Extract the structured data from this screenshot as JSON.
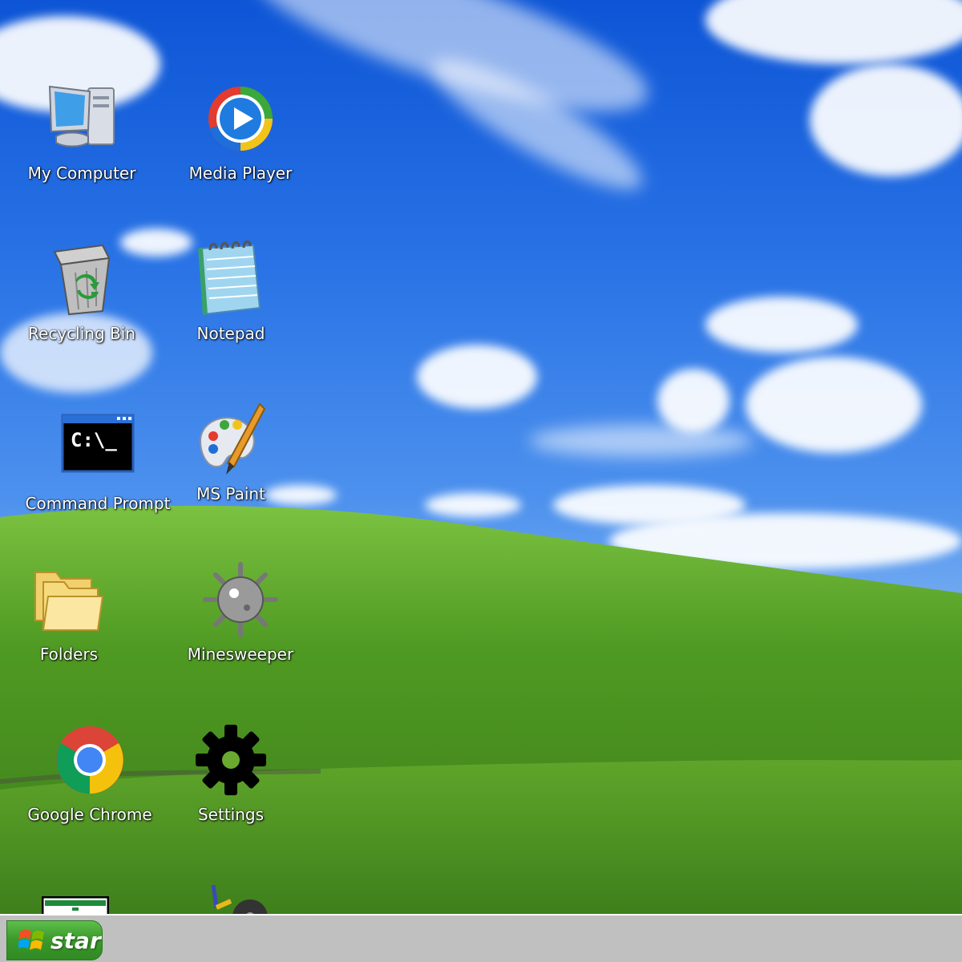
{
  "desktop": {
    "icons": [
      {
        "label": "My Computer",
        "icon": "my-computer-icon"
      },
      {
        "label": "Media Player",
        "icon": "media-player-icon"
      },
      {
        "label": "Recycling Bin",
        "icon": "recycle-bin-icon"
      },
      {
        "label": "Notepad",
        "icon": "notepad-icon"
      },
      {
        "label": "Command Prompt",
        "icon": "command-prompt-icon",
        "glyph_text": "C:\\_"
      },
      {
        "label": "MS Paint",
        "icon": "paint-palette-icon"
      },
      {
        "label": "Folders",
        "icon": "folder-icon"
      },
      {
        "label": "Minesweeper",
        "icon": "mine-icon"
      },
      {
        "label": "Google Chrome",
        "icon": "chrome-icon"
      },
      {
        "label": "Settings",
        "icon": "gear-icon"
      }
    ]
  },
  "taskbar": {
    "start_label": "start",
    "colors": {
      "bar": "#c0c0c0",
      "start_green": "#3c9b2c"
    }
  },
  "colors": {
    "sky": "#2a74e6",
    "grass": "#5a9e2a"
  }
}
